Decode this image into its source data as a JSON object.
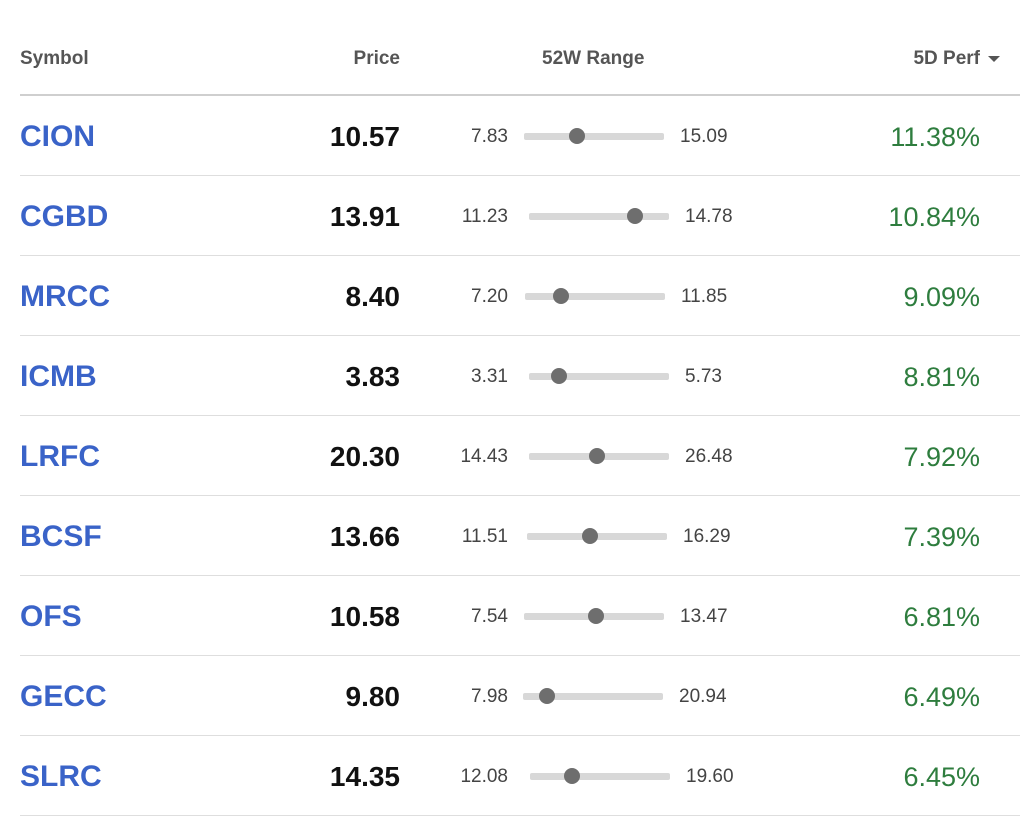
{
  "columns": {
    "symbol": "Symbol",
    "price": "Price",
    "range": "52W Range",
    "perf": "5D Perf"
  },
  "colors": {
    "symbol_link": "#3a63c8",
    "perf_positive": "#2e7d3e",
    "range_marker": "#6e6e6e",
    "range_track": "#d8d8d8"
  },
  "rows": [
    {
      "symbol": "CION",
      "price": "10.57",
      "low": "7.83",
      "high": "15.09",
      "pos": 0.379,
      "perf": "11.38%"
    },
    {
      "symbol": "CGBD",
      "price": "13.91",
      "low": "11.23",
      "high": "14.78",
      "pos": 0.755,
      "perf": "10.84%"
    },
    {
      "symbol": "MRCC",
      "price": "8.40",
      "low": "7.20",
      "high": "11.85",
      "pos": 0.258,
      "perf": "9.09%"
    },
    {
      "symbol": "ICMB",
      "price": "3.83",
      "low": "3.31",
      "high": "5.73",
      "pos": 0.215,
      "perf": "8.81%"
    },
    {
      "symbol": "LRFC",
      "price": "20.30",
      "low": "14.43",
      "high": "26.48",
      "pos": 0.487,
      "perf": "7.92%"
    },
    {
      "symbol": "BCSF",
      "price": "13.66",
      "low": "11.51",
      "high": "16.29",
      "pos": 0.45,
      "perf": "7.39%"
    },
    {
      "symbol": "OFS",
      "price": "10.58",
      "low": "7.54",
      "high": "13.47",
      "pos": 0.513,
      "perf": "6.81%"
    },
    {
      "symbol": "GECC",
      "price": "9.80",
      "low": "7.98",
      "high": "20.94",
      "pos": 0.174,
      "perf": "6.49%"
    },
    {
      "symbol": "SLRC",
      "price": "14.35",
      "low": "12.08",
      "high": "19.60",
      "pos": 0.302,
      "perf": "6.45%"
    }
  ]
}
